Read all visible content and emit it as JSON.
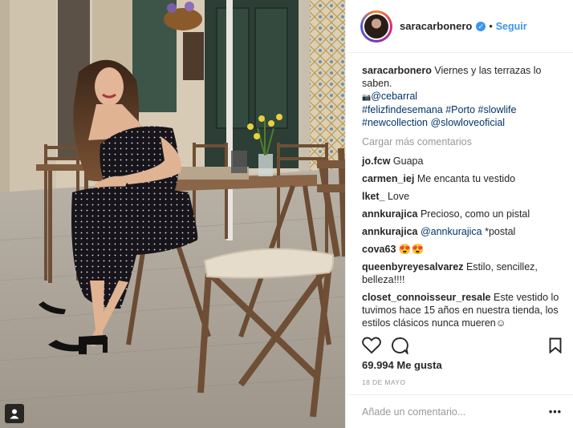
{
  "post": {
    "username": "saracarbonero",
    "follow_label": "Seguir",
    "dot": "•",
    "verified_glyph": "✓"
  },
  "caption": {
    "username": "saracarbonero",
    "line1": "Viernes y las terrazas lo saben.",
    "camera_glyph": "📷",
    "mention1": "@cebarral",
    "tags_line1": "#felizfindesemana #Porto #slowlife",
    "tags_line2a": "#newcollection",
    "mention2": "@slowloveoficial"
  },
  "load_more": "Cargar más comentarios",
  "comments": [
    {
      "user": "jo.fcw",
      "text": "Guapa"
    },
    {
      "user": "carmen_iej",
      "text": "Me encanta tu vestido"
    },
    {
      "user": "lket_",
      "text": "Love"
    },
    {
      "user": "annkurajica",
      "text": "Precioso, como un pistal"
    },
    {
      "user": "annkurajica",
      "mention": "@annkurajica",
      "text": "*postal"
    },
    {
      "user": "cova63",
      "text": "😍😍"
    },
    {
      "user": "queenbyreyesalvarez",
      "text": "Estilo, sencillez, belleza!!!!"
    },
    {
      "user": "closet_connoisseur_resale",
      "text": "Este vestido lo tuvimos hace 15 años en nuestra tienda, los estilos clásicos nunca mueren☺"
    }
  ],
  "likes": "69.994 Me gusta",
  "date": "18 DE MAYO",
  "add_comment": {
    "placeholder": "Añade un comentario...",
    "options": "•••"
  }
}
